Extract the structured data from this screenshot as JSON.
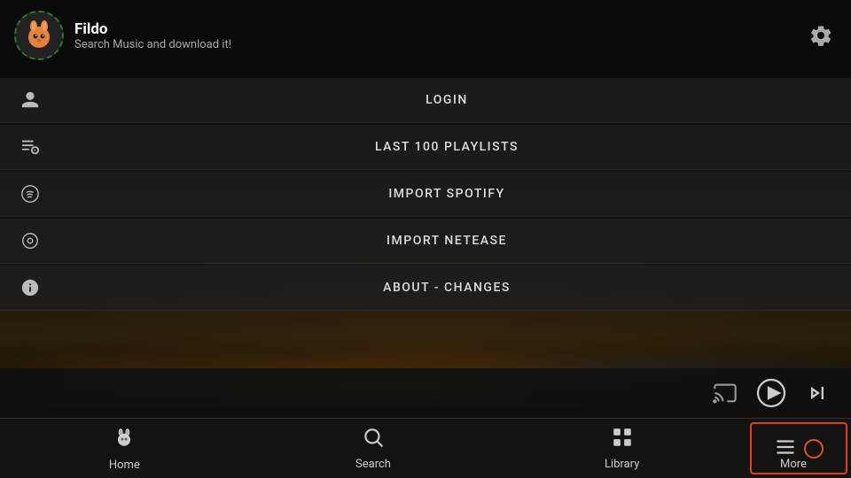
{
  "app": {
    "name": "Fildo",
    "subtitle": "Search Music and download it!"
  },
  "menu": {
    "items": [
      {
        "id": "login",
        "label": "LOGIN",
        "icon": "person"
      },
      {
        "id": "last100",
        "label": "LAST 100 PLAYLISTS",
        "icon": "playlist"
      },
      {
        "id": "spotify",
        "label": "IMPORT SPOTIFY",
        "icon": "spotify"
      },
      {
        "id": "netease",
        "label": "IMPORT NETEASE",
        "icon": "netease"
      },
      {
        "id": "about",
        "label": "ABOUT - CHANGES",
        "icon": "info"
      }
    ]
  },
  "nav": {
    "items": [
      {
        "id": "home",
        "label": "Home",
        "icon": "home",
        "active": false
      },
      {
        "id": "search",
        "label": "Search",
        "icon": "search",
        "active": false
      },
      {
        "id": "library",
        "label": "Library",
        "icon": "library",
        "active": false
      },
      {
        "id": "more",
        "label": "More",
        "icon": "more",
        "active": true
      }
    ]
  },
  "playback": {
    "cast_label": "Cast",
    "play_label": "Play",
    "skip_label": "Skip"
  }
}
